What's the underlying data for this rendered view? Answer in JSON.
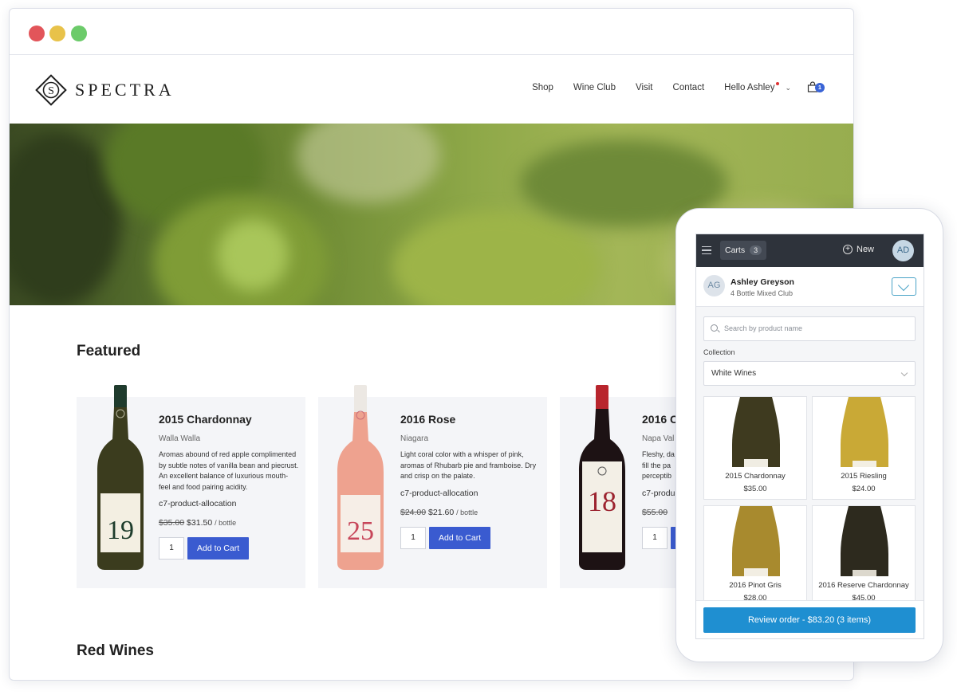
{
  "browser": {
    "window_controls": [
      "close",
      "minimize",
      "maximize"
    ]
  },
  "site": {
    "brand": "SPECTRA",
    "nav": [
      "Shop",
      "Wine Club",
      "Visit",
      "Contact"
    ],
    "user_greeting": "Hello Ashley",
    "cart_count": "1"
  },
  "featured": {
    "title": "Featured",
    "products": [
      {
        "name": "2015 Chardonnay",
        "region": "Walla Walla",
        "description": "Aromas abound of red apple complimented by subtle notes of vanilla bean and piecrust. An excellent balance of luxurious mouth-feel and food pairing acidity.",
        "allocation": "c7-product-allocation",
        "price_old": "$35.00",
        "price_new": "$31.50",
        "unit": "/ bottle",
        "qty": "1",
        "button": "Add to Cart",
        "label_number": "19"
      },
      {
        "name": "2016 Rose",
        "region": "Niagara",
        "description": "Light coral color with a whisper of pink, aromas of Rhubarb pie and framboise. Dry and crisp on the palate.",
        "allocation": "c7-product-allocation",
        "price_old": "$24.00",
        "price_new": "$21.60",
        "unit": "/ bottle",
        "qty": "1",
        "button": "Add to Cart",
        "label_number": "25"
      },
      {
        "name": "2016 C",
        "region": "Napa Val",
        "description": "Fleshy, da fill the pa perceptib",
        "allocation": "c7-produ",
        "price_old": "$55.00",
        "qty": "1",
        "label_number": "18"
      }
    ]
  },
  "red_wines": {
    "title": "Red Wines"
  },
  "phone": {
    "carts_label": "Carts",
    "carts_count": "3",
    "new_label": "New",
    "avatar_initials": "AD",
    "customer": {
      "initials": "AG",
      "name": "Ashley Greyson",
      "club": "4 Bottle Mixed Club"
    },
    "search_placeholder": "Search by product name",
    "collection_label": "Collection",
    "collection_value": "White Wines",
    "products": [
      {
        "name": "2015 Chardonnay",
        "price": "$35.00"
      },
      {
        "name": "2015 Riesling",
        "price": "$24.00"
      },
      {
        "name": "2016 Pinot Gris",
        "price": "$28.00"
      },
      {
        "name": "2016 Reserve Chardonnay",
        "price": "$45.00"
      }
    ],
    "review_button": "Review order - $83.20 (3 items)"
  },
  "colors": {
    "add_button": "#3a5bd0",
    "review_button": "#1f8fd1",
    "card_bg": "#f4f5f8",
    "phone_topbar": "#2e333b"
  }
}
